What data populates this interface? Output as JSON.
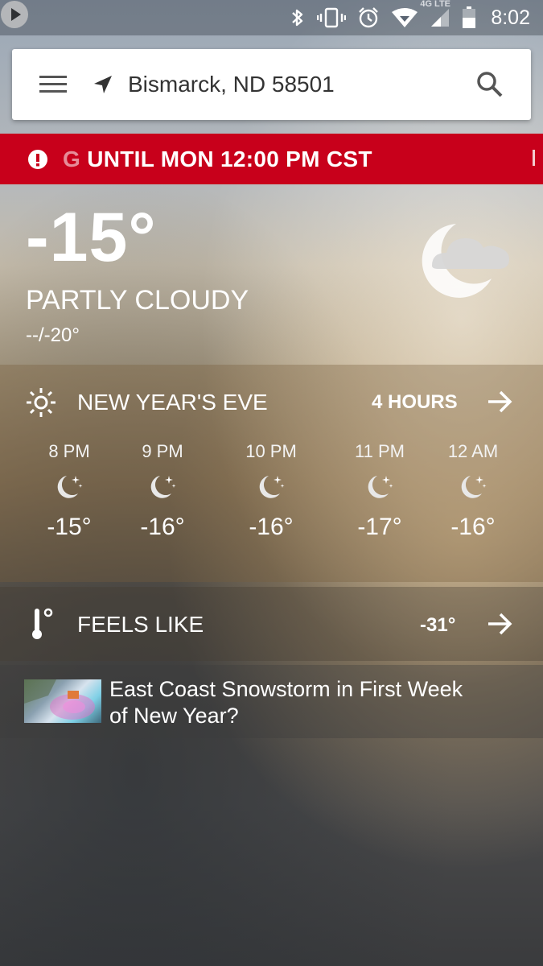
{
  "status_bar": {
    "network": "4G LTE",
    "time": "8:02",
    "icons": [
      "bluetooth-icon",
      "vibrate-icon",
      "alarm-icon",
      "wifi-icon",
      "signal-icon",
      "battery-icon"
    ]
  },
  "search_bar": {
    "location": "Bismarck, ND 58501",
    "icons": [
      "menu-icon",
      "location-arrow-icon",
      "search-icon"
    ]
  },
  "alert": {
    "text_faded": "G",
    "text": "UNTIL MON 12:00 PM CST",
    "color": "#c8001b",
    "icon": "alert-icon"
  },
  "current": {
    "temperature": "-15°",
    "condition": "PARTLY CLOUDY",
    "hi_lo": "--/-20°",
    "icon": "partly-cloudy-night-icon"
  },
  "hourly": {
    "title": "NEW YEAR'S EVE",
    "link_label": "4 HOURS",
    "items": [
      {
        "time": "8 PM",
        "temp": "-15°",
        "icon": "clear-night-icon"
      },
      {
        "time": "9 PM",
        "temp": "-16°",
        "icon": "clear-night-icon"
      },
      {
        "time": "10 PM",
        "temp": "-16°",
        "icon": "clear-night-icon"
      },
      {
        "time": "11 PM",
        "temp": "-17°",
        "icon": "clear-night-icon"
      },
      {
        "time": "12 AM",
        "temp": "-16°",
        "icon": "clear-night-icon"
      }
    ]
  },
  "feels_like": {
    "label": "FEELS LIKE",
    "value": "-31°"
  },
  "video": {
    "headline": "East Coast Snowstorm in First Week of New Year?"
  }
}
